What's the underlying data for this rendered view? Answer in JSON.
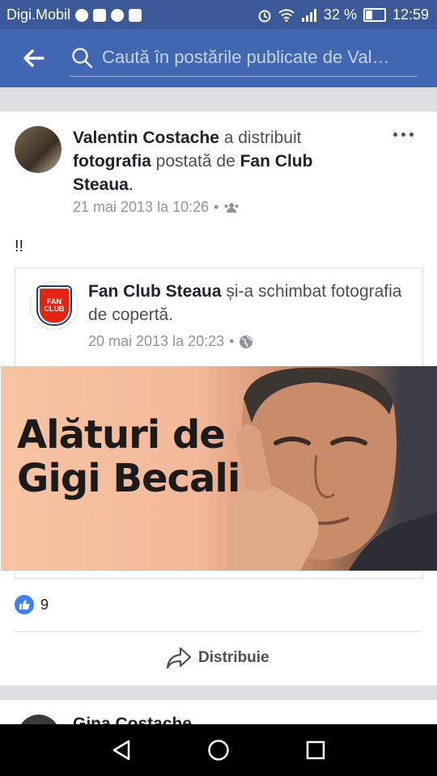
{
  "status_bar": {
    "carrier": "Digi.Mobil",
    "battery_text": "32 %",
    "battery_level": 0.32,
    "time": "12:59",
    "icons": [
      "messenger-icon",
      "facebook-icon",
      "music-app-icon",
      "youtube-icon",
      "alarm-icon",
      "wifi-icon",
      "signal-icon",
      "battery-icon"
    ]
  },
  "header": {
    "search_placeholder": "Caută în postările publicate de Val…",
    "accent_color": "#4267b2"
  },
  "post": {
    "author": "Valentin Costache",
    "action_text": "a distribuit",
    "object": "fotografia",
    "posted_by_text": "postată de",
    "page": "Fan Club Steaua",
    "period": ".",
    "timestamp": "21 mai 2013 la 10:26",
    "separator": "•",
    "privacy_icon": "friends-icon",
    "text": "!!",
    "shared": {
      "page": "Fan Club Steaua",
      "action": "și-a schimbat fotografia de copertă.",
      "timestamp": "20 mai 2013 la 20:23",
      "separator": "•",
      "privacy_icon": "globe-icon",
      "crest_text": "FAN CLUB",
      "cover_text_line1": "Alături de",
      "cover_text_line2": "Gigi Becali"
    },
    "like_count": "9",
    "share_label": "Distribuie"
  },
  "next_post": {
    "author": "Gina Costache"
  }
}
